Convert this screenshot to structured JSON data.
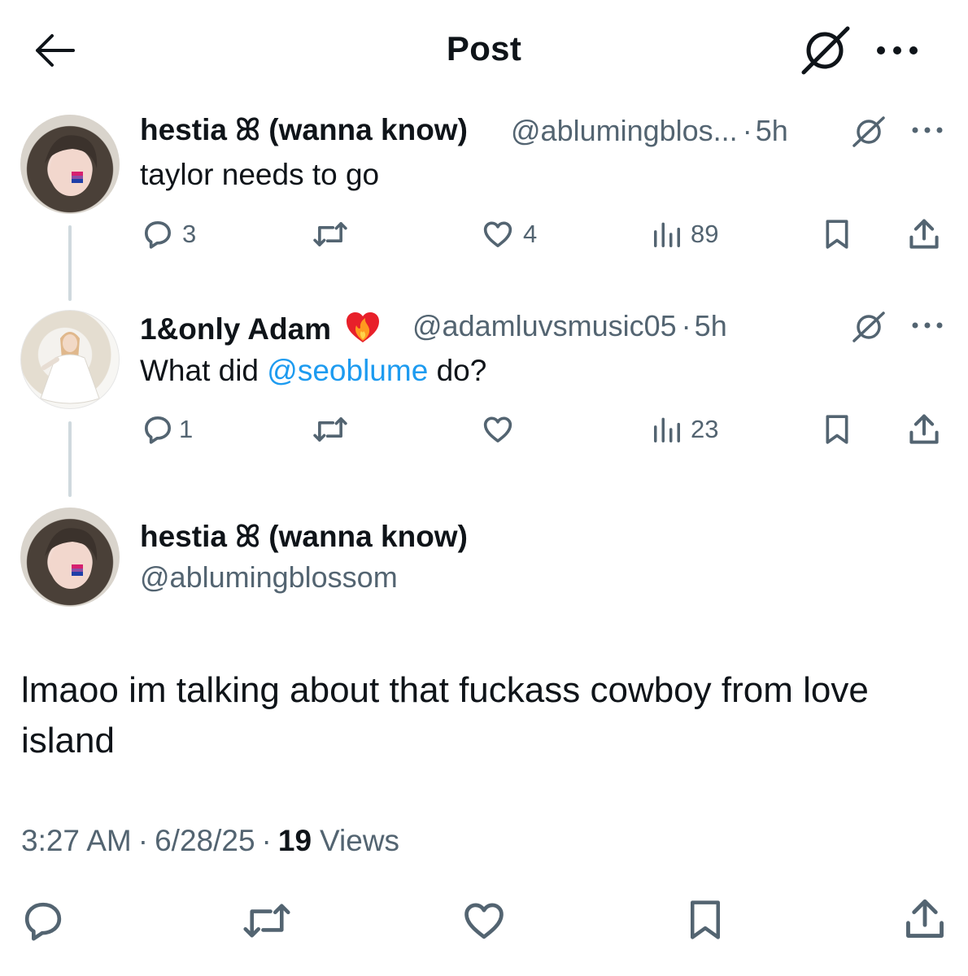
{
  "header": {
    "title": "Post",
    "back_icon": "arrow-left-icon",
    "grok_icon": "grok-icon",
    "more_icon": "more-icon"
  },
  "thread": [
    {
      "display_name": "hestia ꕤ (wanna know)",
      "handle": "@ablumingblos...",
      "separator": "·",
      "time": "5h",
      "text": "taylor needs to go",
      "replies": "3",
      "reposts": "",
      "likes": "4",
      "views": "89"
    },
    {
      "display_name": "1&only Adam",
      "name_emoji": "❤️‍🔥",
      "handle": "@adamluvsmusic05",
      "separator": "·",
      "time": "5h",
      "text_before": "What did ",
      "mention": "@seoblume",
      "text_after": " do?",
      "replies": "1",
      "reposts": "",
      "likes": "",
      "views": "23"
    }
  ],
  "main_post": {
    "display_name": "hestia ꕤ (wanna know)",
    "handle": "@ablumingblossom",
    "text": "lmaoo im talking about that fuckass cowboy from love island",
    "time": "3:27 AM",
    "separator": "·",
    "date": "6/28/25",
    "views_count": "19",
    "views_label": "Views"
  },
  "colors": {
    "text": "#0f1419",
    "secondary": "#536471",
    "link": "#1d9bf0",
    "thread_line": "#cfd9de"
  }
}
